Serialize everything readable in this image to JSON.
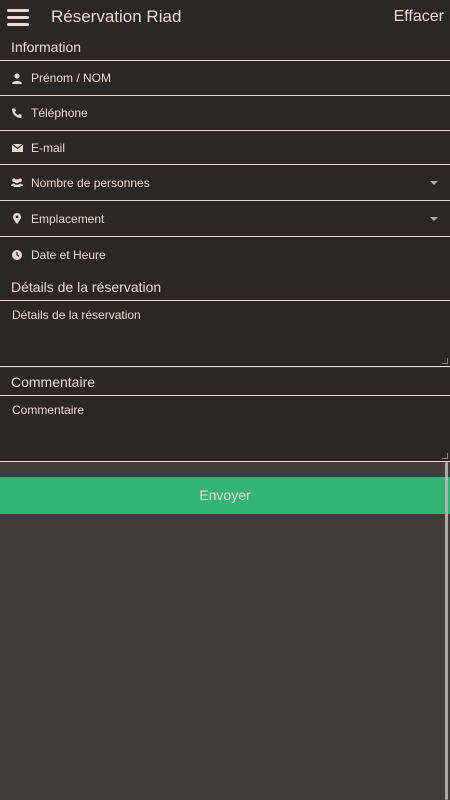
{
  "header": {
    "title": "Réservation Riad",
    "action_label": "Effacer",
    "menu_icon": "hamburger-menu-icon"
  },
  "sections": {
    "information": "Information",
    "details": "Détails de la réservation",
    "comment": "Commentaire"
  },
  "fields": {
    "name": {
      "placeholder": "Prénom / NOM",
      "icon": "person-icon"
    },
    "phone": {
      "placeholder": "Téléphone",
      "icon": "phone-icon"
    },
    "email": {
      "placeholder": "E-mail",
      "icon": "envelope-icon"
    },
    "people": {
      "placeholder": "Nombre de personnes",
      "icon": "group-icon"
    },
    "location": {
      "placeholder": "Emplacement",
      "icon": "map-pin-icon"
    },
    "datetime": {
      "placeholder": "Date et Heure",
      "icon": "clock-icon"
    },
    "details": {
      "placeholder": "Détails de la réservation"
    },
    "comment": {
      "placeholder": "Commentaire"
    }
  },
  "submit_label": "Envoyer",
  "colors": {
    "background": "#3f3c3b",
    "panel": "#2a2727",
    "text": "#f3d6d2",
    "accent_button": "#32b574"
  }
}
